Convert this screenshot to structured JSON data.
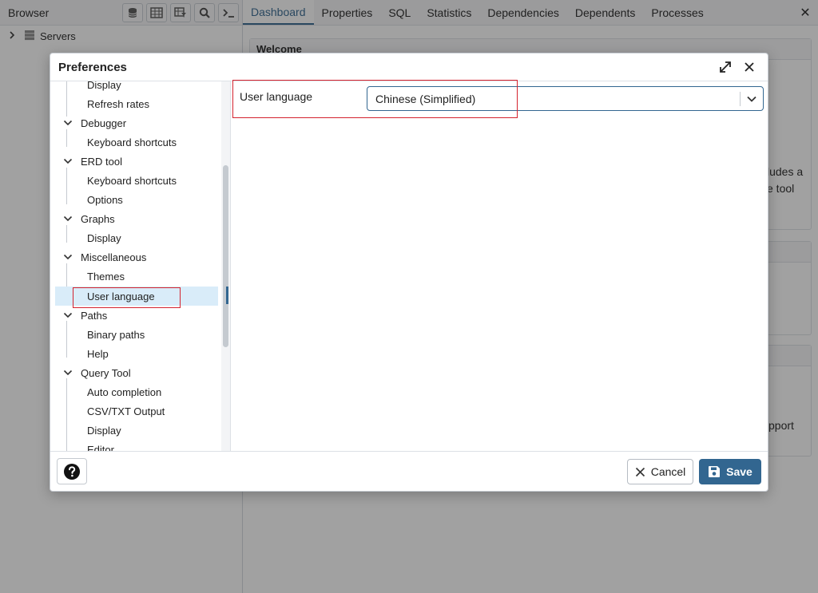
{
  "browser": {
    "title": "Browser",
    "toolbar_icons": [
      "database-icon",
      "table-icon",
      "filter-table-icon",
      "search-icon",
      "terminal-icon"
    ],
    "tree": [
      {
        "label": "Servers",
        "icon": "server-stack-icon"
      }
    ]
  },
  "main": {
    "tabs": [
      "Dashboard",
      "Properties",
      "SQL",
      "Statistics",
      "Dependencies",
      "Dependents",
      "Processes"
    ],
    "active_tab": "Dashboard",
    "welcome_title": "Welcome",
    "partial_text_1": "ludes a",
    "partial_text_2": "e tool",
    "partial_text_3": "pport"
  },
  "dialog": {
    "title": "Preferences",
    "nav": [
      {
        "label": "Display",
        "level": 2
      },
      {
        "label": "Refresh rates",
        "level": 2
      },
      {
        "label": "Debugger",
        "level": 1
      },
      {
        "label": "Keyboard shortcuts",
        "level": 2
      },
      {
        "label": "ERD tool",
        "level": 1
      },
      {
        "label": "Keyboard shortcuts",
        "level": 2
      },
      {
        "label": "Options",
        "level": 2
      },
      {
        "label": "Graphs",
        "level": 1
      },
      {
        "label": "Display",
        "level": 2
      },
      {
        "label": "Miscellaneous",
        "level": 1
      },
      {
        "label": "Themes",
        "level": 2
      },
      {
        "label": "User language",
        "level": 2,
        "selected": true
      },
      {
        "label": "Paths",
        "level": 1
      },
      {
        "label": "Binary paths",
        "level": 2
      },
      {
        "label": "Help",
        "level": 2
      },
      {
        "label": "Query Tool",
        "level": 1
      },
      {
        "label": "Auto completion",
        "level": 2
      },
      {
        "label": "CSV/TXT Output",
        "level": 2
      },
      {
        "label": "Display",
        "level": 2
      },
      {
        "label": "Editor",
        "level": 2
      }
    ],
    "field": {
      "label": "User language",
      "value": "Chinese (Simplified)"
    },
    "buttons": {
      "cancel": "Cancel",
      "save": "Save"
    },
    "colors": {
      "accent": "#326690",
      "selected_bg": "#d9ecf9",
      "highlight": "#d4222e"
    }
  }
}
